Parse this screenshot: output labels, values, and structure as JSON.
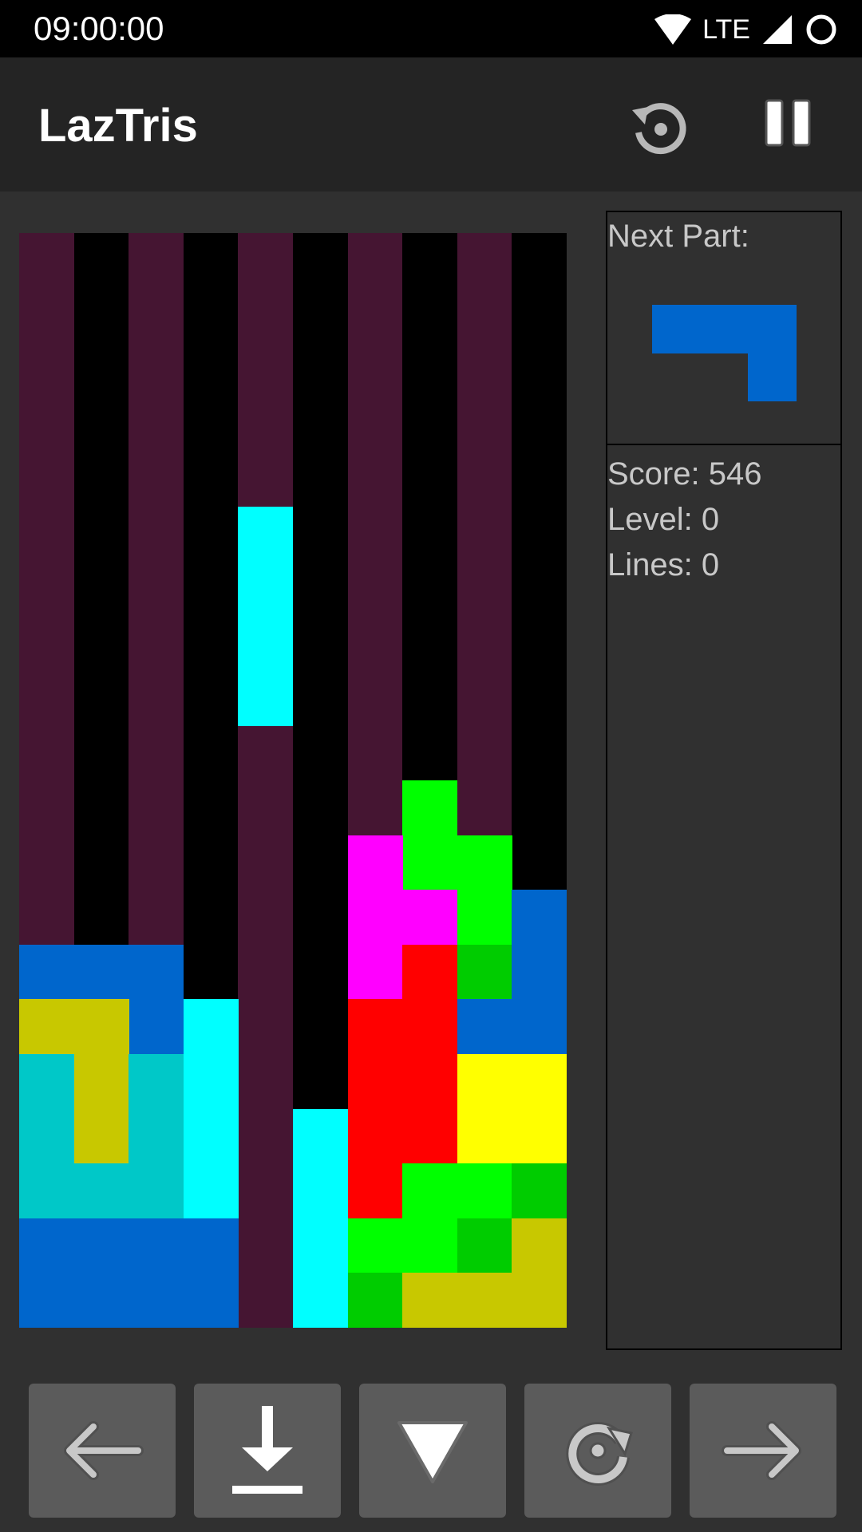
{
  "status_bar": {
    "time": "09:00:00",
    "network": "LTE"
  },
  "app_bar": {
    "title": "LazTris",
    "restart_icon": "restart-icon",
    "pause_icon": "pause-icon"
  },
  "board": {
    "columns": 10,
    "rows": 20,
    "column_stripe_colors": [
      "#451532",
      "#000000"
    ],
    "pieces": [
      {
        "color": "#00ffff",
        "cells": [
          [
            4,
            5
          ],
          [
            4,
            6
          ],
          [
            4,
            7
          ],
          [
            4,
            8
          ]
        ]
      },
      {
        "color": "#00ff00",
        "cells": [
          [
            7,
            10
          ],
          [
            7,
            11
          ],
          [
            8,
            11
          ],
          [
            8,
            12
          ]
        ]
      },
      {
        "color": "#ff00ff",
        "cells": [
          [
            6,
            11
          ],
          [
            6,
            12
          ],
          [
            7,
            12
          ],
          [
            6,
            13
          ]
        ]
      },
      {
        "color": "#00cc00",
        "cells": [
          [
            8,
            13
          ]
        ]
      },
      {
        "color": "#0066cc",
        "cells": [
          [
            9,
            12
          ],
          [
            9,
            13
          ],
          [
            8,
            14
          ],
          [
            9,
            14
          ]
        ]
      },
      {
        "color": "#0066cc",
        "cells": [
          [
            0,
            13
          ],
          [
            1,
            13
          ],
          [
            2,
            13
          ],
          [
            2,
            14
          ]
        ]
      },
      {
        "color": "#c8c800",
        "cells": [
          [
            0,
            14
          ],
          [
            1,
            14
          ],
          [
            1,
            15
          ],
          [
            1,
            16
          ]
        ]
      },
      {
        "color": "#00c8c8",
        "cells": [
          [
            0,
            15
          ],
          [
            0,
            16
          ],
          [
            0,
            17
          ],
          [
            1,
            17
          ],
          [
            2,
            15
          ],
          [
            2,
            16
          ],
          [
            2,
            17
          ]
        ]
      },
      {
        "color": "#00ffff",
        "cells": [
          [
            3,
            14
          ],
          [
            3,
            15
          ],
          [
            3,
            16
          ],
          [
            3,
            17
          ]
        ]
      },
      {
        "color": "#ff0000",
        "cells": [
          [
            7,
            13
          ],
          [
            6,
            14
          ],
          [
            7,
            14
          ],
          [
            6,
            15
          ],
          [
            7,
            15
          ],
          [
            6,
            16
          ],
          [
            7,
            16
          ],
          [
            6,
            17
          ]
        ]
      },
      {
        "color": "#ffff00",
        "cells": [
          [
            8,
            15
          ],
          [
            9,
            15
          ],
          [
            8,
            16
          ],
          [
            9,
            16
          ]
        ]
      },
      {
        "color": "#00ff00",
        "cells": [
          [
            7,
            17
          ],
          [
            8,
            17
          ],
          [
            6,
            18
          ],
          [
            7,
            18
          ]
        ]
      },
      {
        "color": "#00cc00",
        "cells": [
          [
            9,
            17
          ],
          [
            8,
            18
          ],
          [
            6,
            19
          ]
        ]
      },
      {
        "color": "#c8c800",
        "cells": [
          [
            9,
            18
          ],
          [
            7,
            19
          ],
          [
            8,
            19
          ],
          [
            9,
            19
          ]
        ]
      },
      {
        "color": "#00ffff",
        "cells": [
          [
            5,
            16
          ],
          [
            5,
            17
          ],
          [
            5,
            18
          ],
          [
            5,
            19
          ]
        ]
      },
      {
        "color": "#0066cc",
        "cells": [
          [
            0,
            18
          ],
          [
            1,
            18
          ],
          [
            2,
            18
          ],
          [
            3,
            18
          ],
          [
            0,
            19
          ],
          [
            1,
            19
          ],
          [
            2,
            19
          ],
          [
            3,
            19
          ]
        ]
      }
    ]
  },
  "side_panel": {
    "next_label": "Next Part:",
    "next_piece": {
      "color": "#0066cc",
      "cells": [
        [
          0,
          0
        ],
        [
          1,
          0
        ],
        [
          2,
          0
        ],
        [
          2,
          1
        ]
      ]
    },
    "score_text": "Score: 546",
    "level_text": "Level: 0",
    "lines_text": "Lines: 0"
  },
  "controls": [
    {
      "name": "move-left-button",
      "icon": "arrow-left-icon"
    },
    {
      "name": "hard-drop-button",
      "icon": "drop-to-bottom-icon"
    },
    {
      "name": "soft-drop-button",
      "icon": "triangle-down-icon"
    },
    {
      "name": "rotate-button",
      "icon": "rotate-clockwise-icon"
    },
    {
      "name": "move-right-button",
      "icon": "arrow-right-icon"
    }
  ],
  "colors": {
    "background": "#303030",
    "app_bar": "#242424",
    "status_bar": "#000000",
    "button": "#5b5b5b",
    "panel_text": "#c8c8c8"
  }
}
